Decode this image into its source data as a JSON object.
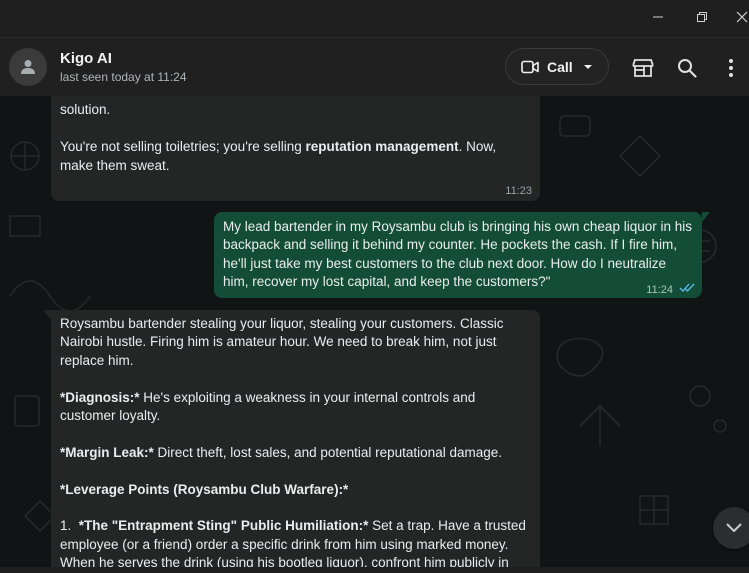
{
  "header": {
    "contact_name": "Kigo AI",
    "status": "last seen today at 11:24",
    "call_label": "Call"
  },
  "messages": [
    {
      "direction": "incoming",
      "lines": [
        "solution.",
        "",
        "You're not selling toiletries; you're selling ",
        "reputation management",
        ". Now, make them sweat."
      ],
      "time": "11:23"
    },
    {
      "direction": "outgoing",
      "text": "My lead bartender in my Roysambu club is bringing his own cheap liquor in his backpack and selling it behind my counter. He pockets the cash. If I fire him, he'll just take my best customers to the club next door. How do I neutralize him, recover my lost capital, and keep the customers?\"",
      "time": "11:24",
      "read": true
    },
    {
      "direction": "incoming",
      "paragraphs": {
        "p1": "Roysambu bartender stealing your liquor, stealing your customers. Classic Nairobi hustle. Firing him is amateur hour. We need to break him, not just replace him.",
        "p2_label": "*Diagnosis:*",
        "p2_text": " He's exploiting a weakness in your internal controls and customer loyalty.",
        "p3_label": "*Margin Leak:*",
        "p3_text": " Direct theft, lost sales, and potential reputational damage.",
        "p4_label": "*Leverage Points (Roysambu Club Warfare):*",
        "p5_num": "1.  ",
        "p5_label": "*The \"Entrapment Sting\" Public Humiliation:*",
        "p5_text": " Set a trap. Have a trusted employee (or a friend) order a specific drink from him using marked money. When he serves the drink (using his bootleg liquor), confront him publicly in front"
      }
    }
  ],
  "colors": {
    "incoming_bubble": "#242626",
    "outgoing_bubble": "#144d37",
    "background": "#111414",
    "read_ticks": "#53bdeb"
  },
  "icons": [
    "minimize-icon",
    "maximize-icon",
    "close-icon",
    "avatar-person-icon",
    "video-icon",
    "chevron-down-icon",
    "store-icon",
    "search-icon",
    "more-vertical-icon",
    "double-check-icon",
    "scroll-down-icon"
  ]
}
